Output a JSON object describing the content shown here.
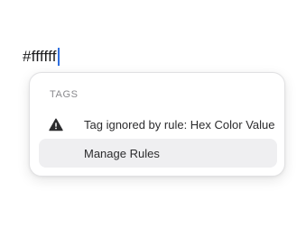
{
  "editor": {
    "typed_text": "#ffffff"
  },
  "popup": {
    "section_header": "TAGS",
    "items": [
      {
        "label": "Tag ignored by rule: Hex Color Value",
        "icon": "warning-triangle-icon"
      },
      {
        "label": "Manage Rules",
        "highlighted": true
      }
    ]
  },
  "colors": {
    "caret": "#2f6fdf",
    "highlight": "#efeff1",
    "text": "#2c2c2e",
    "muted": "#8a8a8e"
  }
}
